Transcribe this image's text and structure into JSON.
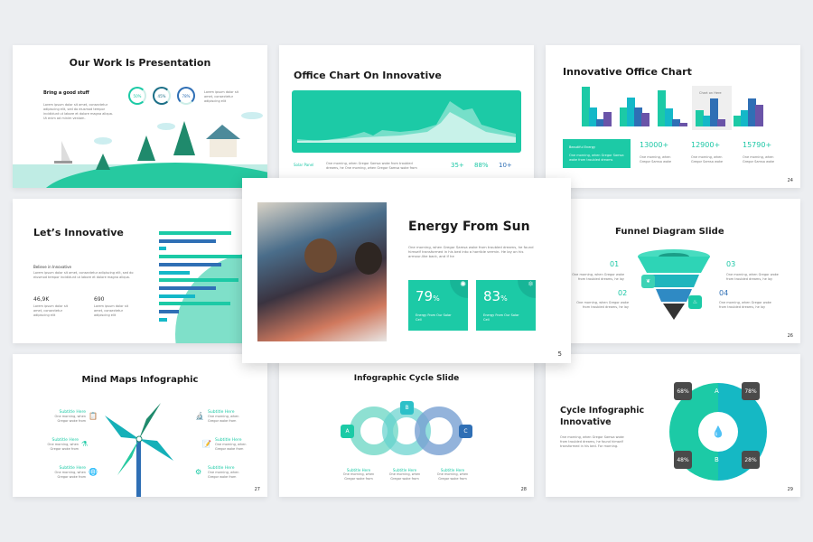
{
  "colors": {
    "teal": "#1ccaa6",
    "blue": "#2f6fb5",
    "purple": "#6a54a8",
    "cyan": "#14b8c8",
    "dark": "#4a4a4a"
  },
  "slides": {
    "s1": {
      "title": "Our Work Is Presentation",
      "subtitle": "Bring a good stuff",
      "body": "Lorem ipsum dolor sit amet, consectetur adipiscing elit, sed do eiusmod tempor incididunt ut labore et dolore magna aliqua. Ut enim ad minim veniam.",
      "side_text": "Lorem ipsum dolor sit amet, consectetur adipiscing elit",
      "rings": [
        {
          "label": "50%",
          "value": 50
        },
        {
          "label": "45%",
          "value": 45
        },
        {
          "label": "78%",
          "value": 78
        }
      ]
    },
    "s2": {
      "title": "Office Chart On Innovative",
      "label": "Solar Panel",
      "body": "One morning, when Gregor Samsa woke from troubled dreams, he One morning, when Gregor Samsa woke from",
      "stats": [
        "35+",
        "88%",
        "10+"
      ]
    },
    "s3": {
      "title": "Innovative Office Chart",
      "highlight_label": "Chart on Here",
      "card_title": "Beautiful Energy",
      "card_body": "One morning, when Gregor Samsa woke from troubled dreams",
      "stats": [
        {
          "value": "13000+",
          "text": "One morning, when Gregor Samsa woke"
        },
        {
          "value": "12900+",
          "text": "One morning, when Gregor Samsa woke"
        },
        {
          "value": "15790+",
          "text": "One morning, when Gregor Samsa woke"
        }
      ],
      "groups": [
        [
          100,
          48,
          18,
          36
        ],
        [
          48,
          72,
          48,
          34
        ],
        [
          90,
          45,
          18,
          10
        ],
        [
          42,
          28,
          70,
          18
        ],
        [
          28,
          40,
          70,
          54
        ]
      ],
      "page": "24"
    },
    "s4": {
      "title": "Let’s Innovative",
      "subtitle": "Believe in Innovative",
      "body": "Lorem ipsum dolor sit amet, consectetur adipiscing elit, sed do eiusmod tempor incididunt ut labore et dolore magna aliqua.",
      "stats": [
        {
          "value": "46,9K",
          "text": "Lorem ipsum dolor sit amet, consectetur adipiscing elit"
        },
        {
          "value": "690",
          "text": "Lorem ipsum dolor sit amet, consectetur adipiscing elit"
        }
      ],
      "bars": [
        80,
        63,
        8,
        100,
        69,
        34,
        88,
        63,
        40,
        79,
        22,
        9
      ]
    },
    "center": {
      "title": "Energy From Sun",
      "body": "One morning, when Gregor Samsa woke from troubled dreams, he found himself transformed in his bed into a horrible vermin. He lay on his armour-like back, and if he",
      "cards": [
        {
          "value": "79",
          "unit": "%",
          "text": "Energy From Our Solar Cell"
        },
        {
          "value": "83",
          "unit": "%",
          "text": "Energy From Our Solar Cell"
        }
      ],
      "page": "5"
    },
    "s6": {
      "title": "Funnel Diagram Slide",
      "steps": [
        {
          "num": "01",
          "text": "One morning, when Gregor woke from troubled dreams, he lay"
        },
        {
          "num": "02",
          "text": "One morning, when Gregor woke from troubled dreams, he lay"
        },
        {
          "num": "03",
          "text": "One morning, when Gregor woke from troubled dreams, he lay"
        },
        {
          "num": "04",
          "text": "One morning, when Gregor woke from troubled dreams, he lay"
        }
      ],
      "page": "26"
    },
    "s7": {
      "title": "Mind Maps Infographic",
      "items": [
        {
          "title": "Subtitle Here",
          "text": "One morning, when Gregor woke from"
        },
        {
          "title": "Subtitle Here",
          "text": "One morning, when Gregor woke from"
        },
        {
          "title": "Subtitle Here",
          "text": "One morning, when Gregor woke from"
        },
        {
          "title": "Subtitle Here",
          "text": "One morning, when Gregor woke from"
        },
        {
          "title": "Subtitle Here",
          "text": "One morning, when Gregor woke from"
        },
        {
          "title": "Subtitle Here",
          "text": "One morning, when Gregor woke from"
        }
      ],
      "page": "27"
    },
    "s8": {
      "title": "Infographic Cycle Slide",
      "labels": [
        "A",
        "B",
        "C"
      ],
      "items": [
        {
          "title": "Subtitle Here",
          "text": "One morning, when Gregor woke from"
        },
        {
          "title": "Subtitle Here",
          "text": "One morning, when Gregor woke from"
        },
        {
          "title": "Subtitle Here",
          "text": "One morning, when Gregor woke from"
        }
      ],
      "page": "28"
    },
    "s9": {
      "title": "Cycle Infographic Innovative",
      "body": "One morning, when Gregor Samsa woke from troubled dreams, he found himself transformed in his bed. For morning.",
      "letters": [
        "A",
        "B"
      ],
      "stats": [
        "68%",
        "78%",
        "48%",
        "28%"
      ],
      "page": "29"
    }
  }
}
